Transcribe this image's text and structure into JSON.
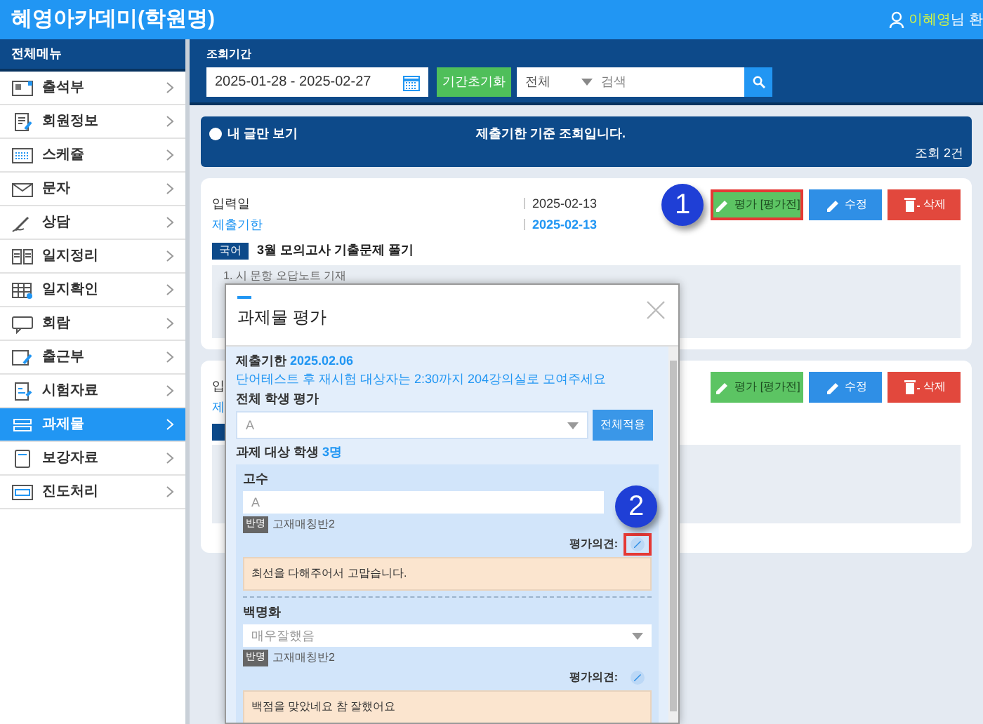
{
  "header": {
    "title": "혜영아카데미(학원명)",
    "user_name": "이혜영",
    "user_suffix": "님 환"
  },
  "sidebar": {
    "title": "전체메뉴",
    "items": [
      {
        "label": "출석부",
        "selected": false
      },
      {
        "label": "회원정보",
        "selected": false
      },
      {
        "label": "스케쥴",
        "selected": false
      },
      {
        "label": "문자",
        "selected": false
      },
      {
        "label": "상담",
        "selected": false
      },
      {
        "label": "일지정리",
        "selected": false
      },
      {
        "label": "일지확인",
        "selected": false
      },
      {
        "label": "회람",
        "selected": false
      },
      {
        "label": "출근부",
        "selected": false
      },
      {
        "label": "시험자료",
        "selected": false
      },
      {
        "label": "과제물",
        "selected": true
      },
      {
        "label": "보강자료",
        "selected": false
      },
      {
        "label": "진도처리",
        "selected": false
      }
    ]
  },
  "filter": {
    "label": "조회기간",
    "date_range": "2025-01-28 - 2025-02-27",
    "reset_button": "기간초기화",
    "category": "전체",
    "search_placeholder": "검색"
  },
  "notice": {
    "toggle": "내 글만 보기",
    "message": "제출기한 기준 조회입니다.",
    "count": "조회 2건"
  },
  "posts": [
    {
      "fields": [
        {
          "label": "입력일",
          "value": "2025-02-13",
          "kind": "plain"
        },
        {
          "label": "제출기한",
          "value": "2025-02-13",
          "kind": "link"
        }
      ],
      "buttons": [
        {
          "label": "평가 [평가전]",
          "kind": "evaluate",
          "highlighted": true,
          "callout": "1"
        },
        {
          "label": "수정",
          "kind": "edit",
          "highlighted": false
        },
        {
          "label": "삭제",
          "kind": "delete",
          "highlighted": false
        }
      ],
      "tag": "국어",
      "title": "3월 모의고사 기출문제 풀기",
      "body": "1. 시 문항 오답노트 기재"
    },
    {
      "fields": [
        {
          "label": "입",
          "kind": "plain"
        },
        {
          "label": "제",
          "kind": "link"
        }
      ],
      "buttons": [
        {
          "label": "평가 [평가전]",
          "kind": "evaluate",
          "highlighted": false
        },
        {
          "label": "수정",
          "kind": "edit",
          "highlighted": false
        },
        {
          "label": "삭제",
          "kind": "delete",
          "highlighted": false
        }
      ]
    }
  ],
  "modal": {
    "title": "과제물 평가",
    "deadline_label": "제출기한",
    "deadline": "2025.02.06",
    "note": "단어테스트 후 재시험 대상자는 2:30까지 204강의실로 모여주세요",
    "all_label": "전체 학생 평가",
    "all_value": "A",
    "apply_button": "전체적용",
    "students_label": "과제 대상 학생",
    "students_count": "3명",
    "students": [
      {
        "name": "고수",
        "grade": "A",
        "kind": "input",
        "class_tag": "반명",
        "class_name": "고재매칭반2",
        "opinion_label": "평가의견:",
        "comment": "최선을 다해주어서 고맙습니다.",
        "highlighted": true,
        "callout": "2"
      },
      {
        "name": "백명화",
        "grade": "매우잘했음",
        "kind": "select",
        "class_tag": "반명",
        "class_name": "고재매칭반2",
        "opinion_label": "평가의견:",
        "comment": "백점을 맞았네요 참 잘했어요",
        "highlighted": false
      }
    ]
  }
}
